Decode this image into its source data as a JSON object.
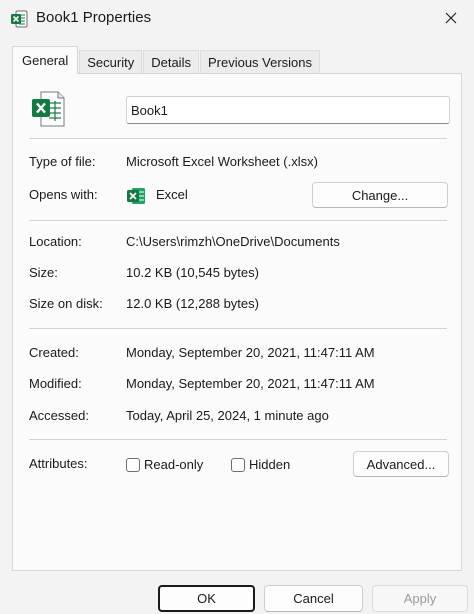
{
  "window": {
    "title": "Book1 Properties",
    "close_icon": "close-icon",
    "app_icon": "excel-icon"
  },
  "tabs": [
    {
      "label": "General",
      "active": true
    },
    {
      "label": "Security",
      "active": false
    },
    {
      "label": "Details",
      "active": false
    },
    {
      "label": "Previous Versions",
      "active": false
    }
  ],
  "general": {
    "file_name": "Book1",
    "type_of_file": {
      "label": "Type of file:",
      "value": "Microsoft Excel Worksheet (.xlsx)"
    },
    "opens_with": {
      "label": "Opens with:",
      "value": "Excel",
      "change_button": "Change..."
    },
    "location": {
      "label": "Location:",
      "value": "C:\\Users\\rimzh\\OneDrive\\Documents"
    },
    "size": {
      "label": "Size:",
      "value": "10.2 KB (10,545 bytes)"
    },
    "size_on_disk": {
      "label": "Size on disk:",
      "value": "12.0 KB (12,288 bytes)"
    },
    "created": {
      "label": "Created:",
      "value": "Monday, September 20, 2021, 11:47:11 AM"
    },
    "modified": {
      "label": "Modified:",
      "value": "Monday, September 20, 2021, 11:47:11 AM"
    },
    "accessed": {
      "label": "Accessed:",
      "value": "Today, April 25, 2024, 1 minute ago"
    },
    "attributes": {
      "label": "Attributes:",
      "read_only": {
        "label": "Read-only",
        "checked": false
      },
      "hidden": {
        "label": "Hidden",
        "checked": false
      },
      "advanced_button": "Advanced..."
    }
  },
  "footer": {
    "ok": "OK",
    "cancel": "Cancel",
    "apply": "Apply"
  },
  "colors": {
    "excel_green": "#107c41",
    "excel_dark_green": "#0b5a2f"
  }
}
